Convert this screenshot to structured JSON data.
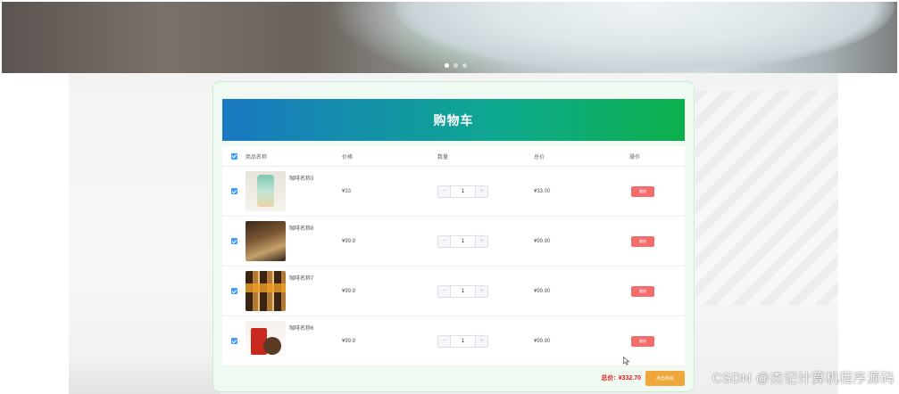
{
  "banner": {
    "slides": 3,
    "active_slide": 0
  },
  "cart": {
    "title": "购物车",
    "columns": {
      "name": "商品名称",
      "price": "价格",
      "quantity": "数量",
      "total": "总价",
      "operation": "操作"
    },
    "items": [
      {
        "name": "咖啡名称3",
        "price": "¥33",
        "quantity": "1",
        "total": "¥33.00",
        "delete_label": "删除"
      },
      {
        "name": "咖啡名称8",
        "price": "¥99.9",
        "quantity": "1",
        "total": "¥99.90",
        "delete_label": "删除"
      },
      {
        "name": "咖啡名称7",
        "price": "¥99.9",
        "quantity": "1",
        "total": "¥99.90",
        "delete_label": "删除"
      },
      {
        "name": "咖啡名称6",
        "price": "¥99.9",
        "quantity": "1",
        "total": "¥99.90",
        "delete_label": "删除"
      }
    ],
    "minus_symbol": "−",
    "plus_symbol": "+",
    "total_label": "总价:",
    "total_value": "¥332.70",
    "checkout_label": "点击购买"
  },
  "watermark": "CSDN @杰记计算机程序源码",
  "colors": {
    "header_start": "#1a78c2",
    "header_end": "#0cb04a",
    "delete": "#f56c6c",
    "checkout": "#f0a73a",
    "total_text": "#e02020",
    "checkbox": "#409eff"
  }
}
